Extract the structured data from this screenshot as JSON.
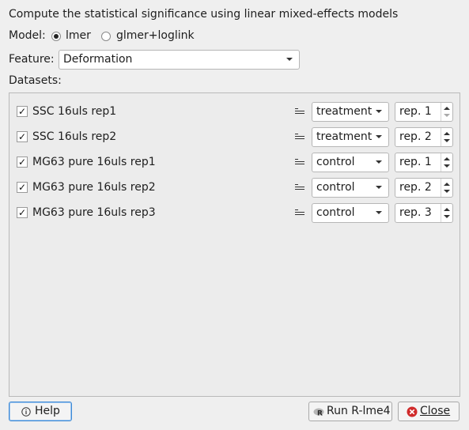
{
  "heading": "Compute the statistical significance using linear mixed-effects models",
  "model": {
    "label": "Model:",
    "options": [
      "lmer",
      "glmer+loglink"
    ],
    "selected": "lmer"
  },
  "feature": {
    "label": "Feature:",
    "value": "Deformation"
  },
  "datasets_label": "Datasets:",
  "datasets": [
    {
      "checked": true,
      "name": "SSC 16uls rep1",
      "group": "treatment",
      "replicate": "rep. 1"
    },
    {
      "checked": true,
      "name": "SSC 16uls rep2",
      "group": "treatment",
      "replicate": "rep. 2"
    },
    {
      "checked": true,
      "name": "MG63 pure 16uls rep1",
      "group": "control",
      "replicate": "rep. 1"
    },
    {
      "checked": true,
      "name": "MG63 pure 16uls rep2",
      "group": "control",
      "replicate": "rep. 2"
    },
    {
      "checked": true,
      "name": "MG63 pure 16uls rep3",
      "group": "control",
      "replicate": "rep. 3"
    }
  ],
  "checkmark": "✓",
  "buttons": {
    "help": "Help",
    "help_icon": "info-icon",
    "run": "Run R-lme4",
    "run_icon": "r-logo-icon",
    "close": "Close",
    "close_icon": "close-circle-icon"
  },
  "colors": {
    "close_icon": "#d02a2a",
    "help_focus": "#3d8ad6"
  }
}
